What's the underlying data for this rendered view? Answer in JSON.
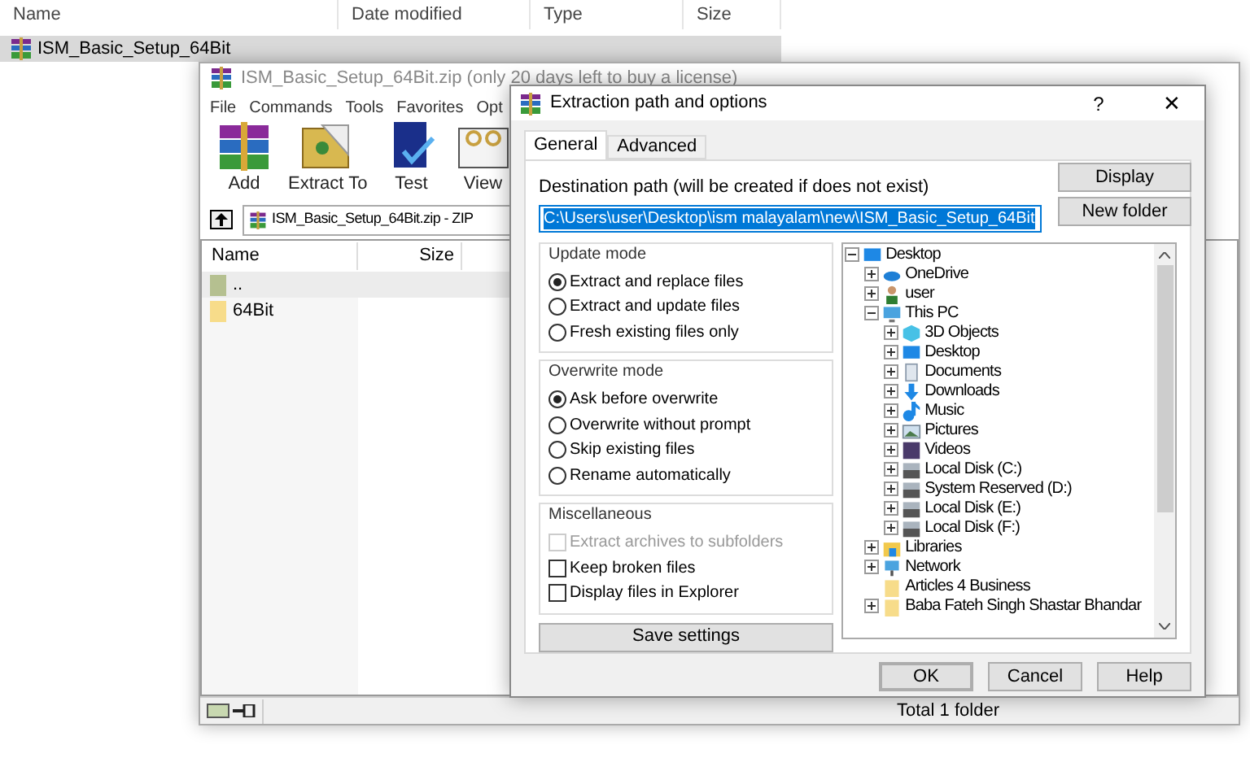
{
  "explorer": {
    "columns": [
      "Name",
      "Date modified",
      "Type",
      "Size"
    ],
    "rows": [
      {
        "name": "ISM_Basic_Setup_64Bit",
        "selected": true
      }
    ]
  },
  "winrar": {
    "title": "ISM_Basic_Setup_64Bit.zip (only 20 days left to buy a license)",
    "menu": [
      "File",
      "Commands",
      "Tools",
      "Favorites",
      "Opt"
    ],
    "toolbar": [
      {
        "kind": "add",
        "label": "Add"
      },
      {
        "kind": "extract",
        "label": "Extract To"
      },
      {
        "kind": "test",
        "label": "Test"
      },
      {
        "kind": "view",
        "label": "View"
      }
    ],
    "address": "ISM_Basic_Setup_64Bit.zip - ZIP",
    "columns": [
      "Name",
      "Size"
    ],
    "rows": [
      {
        "kind": "up",
        "name": "..",
        "selected": true
      },
      {
        "kind": "folder",
        "name": "64Bit",
        "selected": false
      }
    ],
    "status": "Total 1 folder"
  },
  "dialog": {
    "title": "Extraction path and options",
    "help_glyph": "?",
    "close_glyph": "✕",
    "tabs": [
      {
        "label": "General",
        "selected": true
      },
      {
        "label": "Advanced",
        "selected": false
      }
    ],
    "destination_label": "Destination path (will be created if does not exist)",
    "destination_value": "C:\\Users\\user\\Desktop\\ism malayalam\\new\\ISM_Basic_Setup_64Bit",
    "side_buttons": [
      "Display",
      "New folder"
    ],
    "groups": [
      {
        "title": "Update mode",
        "kind": "radio",
        "options": [
          {
            "label": "Extract and replace files",
            "checked": true,
            "disabled": false
          },
          {
            "label": "Extract and update files",
            "checked": false,
            "disabled": false
          },
          {
            "label": "Fresh existing files only",
            "checked": false,
            "disabled": false
          }
        ]
      },
      {
        "title": "Overwrite mode",
        "kind": "radio",
        "options": [
          {
            "label": "Ask before overwrite",
            "checked": true,
            "disabled": false
          },
          {
            "label": "Overwrite without prompt",
            "checked": false,
            "disabled": false
          },
          {
            "label": "Skip existing files",
            "checked": false,
            "disabled": false
          },
          {
            "label": "Rename automatically",
            "checked": false,
            "disabled": false
          }
        ]
      },
      {
        "title": "Miscellaneous",
        "kind": "checkbox",
        "options": [
          {
            "label": "Extract archives to subfolders",
            "checked": false,
            "disabled": true
          },
          {
            "label": "Keep broken files",
            "checked": false,
            "disabled": false
          },
          {
            "label": "Display files in Explorer",
            "checked": false,
            "disabled": false
          }
        ]
      }
    ],
    "save_button": "Save settings",
    "tree": [
      {
        "label": "Desktop",
        "kind": "desktop",
        "expanded": true,
        "children": [
          {
            "label": "OneDrive",
            "kind": "cloud",
            "expanded": false
          },
          {
            "label": "user",
            "kind": "user",
            "expanded": false
          },
          {
            "label": "This PC",
            "kind": "pc",
            "expanded": true,
            "children": [
              {
                "label": "3D Objects",
                "kind": "cube",
                "expanded": false
              },
              {
                "label": "Desktop",
                "kind": "desktop",
                "expanded": false
              },
              {
                "label": "Documents",
                "kind": "documents",
                "expanded": false
              },
              {
                "label": "Downloads",
                "kind": "download",
                "expanded": false
              },
              {
                "label": "Music",
                "kind": "music",
                "expanded": false
              },
              {
                "label": "Pictures",
                "kind": "pictures",
                "expanded": false
              },
              {
                "label": "Videos",
                "kind": "videos",
                "expanded": false
              },
              {
                "label": "Local Disk (C:)",
                "kind": "drive",
                "expanded": false
              },
              {
                "label": "System Reserved (D:)",
                "kind": "drive",
                "expanded": false
              },
              {
                "label": "Local Disk (E:)",
                "kind": "drive",
                "expanded": false
              },
              {
                "label": "Local Disk (F:)",
                "kind": "drive",
                "expanded": false
              }
            ]
          },
          {
            "label": "Libraries",
            "kind": "library",
            "expanded": false
          },
          {
            "label": "Network",
            "kind": "network",
            "expanded": false
          },
          {
            "label": "Articles 4 Business",
            "kind": "folder"
          },
          {
            "label": "Baba Fateh Singh Shastar Bhandar",
            "kind": "folder",
            "expanded": false
          }
        ]
      }
    ],
    "buttons": [
      "OK",
      "Cancel",
      "Help"
    ]
  }
}
